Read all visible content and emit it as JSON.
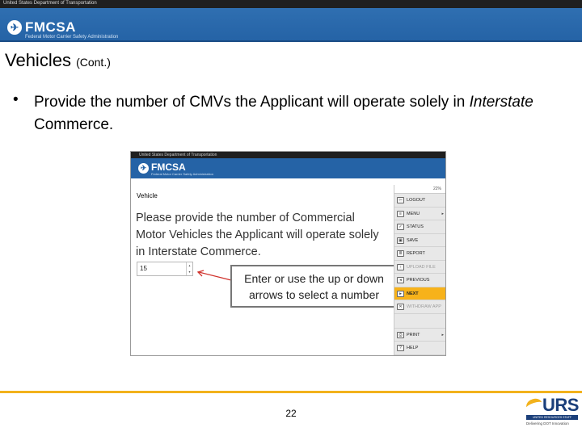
{
  "header": {
    "dot_label": "United States Department of Transportation",
    "fmcsa_title": "FMCSA",
    "fmcsa_subtitle": "Federal Motor Carrier Safety Administration"
  },
  "slide": {
    "title": "Vehicles",
    "title_suffix": "(Cont.)",
    "bullet_symbol": "•",
    "bullet_part1": "Provide the number of CMVs the Applicant will operate solely in ",
    "bullet_emphasis": "Interstate",
    "bullet_part2": " Commerce."
  },
  "screenshot": {
    "dot_label": "United States Department of Transportation",
    "fmcsa_title": "FMCSA",
    "fmcsa_subtitle": "Federal Motor Carrier Safety Administration",
    "section": "Vehicle",
    "question": "Please provide the number of Commercial Motor Vehicles the Applicant will operate solely in Interstate Commerce.",
    "input_value": "15",
    "callout": "Enter or use the up or down arrows to select a number",
    "zoom": "22%",
    "menu": [
      {
        "label": "LOGOUT",
        "icon": "logout-icon",
        "glyph": "⇦",
        "state": "normal"
      },
      {
        "label": "MENU",
        "icon": "menu-icon",
        "glyph": "≡",
        "state": "normal",
        "caret": "▸"
      },
      {
        "label": "STATUS",
        "icon": "status-icon",
        "glyph": "✓",
        "state": "normal"
      },
      {
        "label": "SAVE",
        "icon": "save-icon",
        "glyph": "▣",
        "state": "normal"
      },
      {
        "label": "REPORT",
        "icon": "report-icon",
        "glyph": "≣",
        "state": "normal"
      },
      {
        "label": "UPLOAD FILE",
        "icon": "upload-icon",
        "glyph": "↑",
        "state": "disabled"
      },
      {
        "label": "PREVIOUS",
        "icon": "previous-icon",
        "glyph": "◂",
        "state": "normal"
      },
      {
        "label": "NEXT",
        "icon": "next-icon",
        "glyph": "▸",
        "state": "active"
      },
      {
        "label": "WITHDRAW APP",
        "icon": "withdraw-icon",
        "glyph": "✕",
        "state": "disabled"
      },
      {
        "label": "PRINT",
        "icon": "print-icon",
        "glyph": "⎙",
        "state": "normal",
        "caret": "▸"
      },
      {
        "label": "HELP",
        "icon": "help-icon",
        "glyph": "?",
        "state": "normal"
      }
    ]
  },
  "footer": {
    "page_number": "22",
    "urs_logo_text": "URS",
    "urs_tagline": "UNITED RESOURCES STAFF",
    "urs_subtext": "Delivering DOT Innovation"
  },
  "colors": {
    "banner_blue": "#2563a6",
    "accent_yellow": "#f2b21c",
    "active_menu": "#f7b21a",
    "urs_navy": "#1b3f7a"
  }
}
